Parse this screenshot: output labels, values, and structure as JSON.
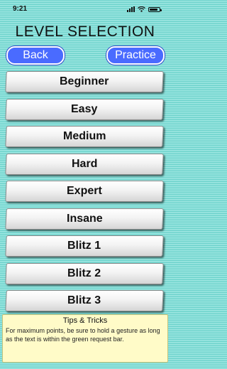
{
  "status": {
    "time": "9:21",
    "battery_level": 0.85
  },
  "title": "LEVEL SELECTION",
  "nav": {
    "back_label": "Back",
    "practice_label": "Practice"
  },
  "levels": [
    "Beginner",
    "Easy",
    "Medium",
    "Hard",
    "Expert",
    "Insane",
    "Blitz 1",
    "Blitz 2",
    "Blitz 3"
  ],
  "tips": {
    "title": "Tips & Tricks",
    "body": "For maximum points, be sure to hold a gesture as long as the text is within the green request bar."
  },
  "colors": {
    "background": "#7fdcd6",
    "nav_button": "#4a6bff",
    "tips_background": "#fffbc8"
  },
  "icons": [
    "signal-icon",
    "wifi-icon",
    "battery-icon"
  ]
}
